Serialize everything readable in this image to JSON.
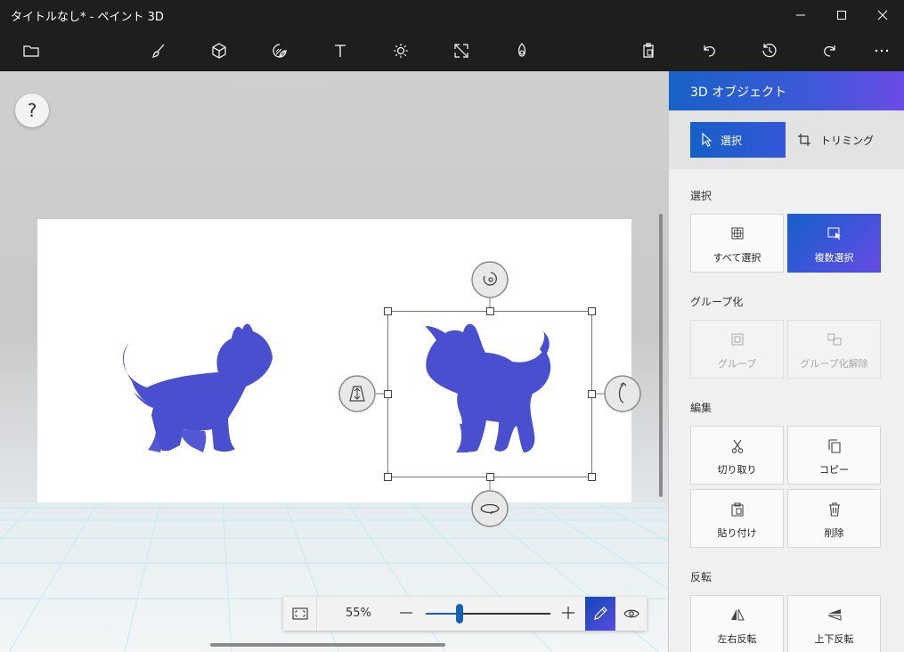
{
  "window": {
    "title": "タイトルなし* - ペイント 3D",
    "controls": [
      "minimize-icon",
      "maximize-icon",
      "close-icon"
    ]
  },
  "toolbar": {
    "left_items": [
      {
        "icon": "folder-icon"
      },
      {
        "icon": "brushes-icon"
      },
      {
        "icon": "3d-shapes-icon"
      },
      {
        "icon": "stickers-icon"
      },
      {
        "icon": "text-icon"
      },
      {
        "icon": "effects-icon"
      },
      {
        "icon": "canvas-icon"
      },
      {
        "icon": "3d-library-icon"
      }
    ],
    "right_items": [
      {
        "icon": "paste-icon"
      },
      {
        "icon": "undo-icon"
      },
      {
        "icon": "history-icon"
      },
      {
        "icon": "redo-icon"
      },
      {
        "icon": "more-icon"
      }
    ]
  },
  "canvas": {
    "help_label": "?",
    "object_color": "#4a4fd0"
  },
  "zoom": {
    "percent_label": "55%",
    "level": 0.27
  },
  "panel": {
    "title": "3D オブジェクト",
    "modes": {
      "select": "選択",
      "crop": "トリミング"
    },
    "sections": {
      "select": {
        "label": "選択",
        "items": [
          {
            "label": "すべて選択",
            "icon": "select-all-icon",
            "state": "normal"
          },
          {
            "label": "複数選択",
            "icon": "multi-select-icon",
            "state": "active"
          }
        ]
      },
      "group": {
        "label": "グループ化",
        "items": [
          {
            "label": "グループ",
            "icon": "group-icon",
            "state": "disabled"
          },
          {
            "label": "グループ化解除",
            "icon": "ungroup-icon",
            "state": "disabled"
          }
        ]
      },
      "edit": {
        "label": "編集",
        "items": [
          {
            "label": "切り取り",
            "icon": "scissors-icon",
            "state": "normal"
          },
          {
            "label": "コピー",
            "icon": "copy-icon",
            "state": "normal"
          },
          {
            "label": "貼り付け",
            "icon": "paste-icon",
            "state": "normal"
          },
          {
            "label": "削除",
            "icon": "trash-icon",
            "state": "normal"
          }
        ]
      },
      "flip": {
        "label": "反転",
        "items": [
          {
            "label": "左右反転",
            "icon": "flip-horizontal-icon",
            "state": "normal"
          },
          {
            "label": "上下反転",
            "icon": "flip-vertical-icon",
            "state": "normal"
          }
        ]
      }
    }
  },
  "colors": {
    "accent": "#1560c8",
    "accent_end": "#6a4ae4",
    "titlebar": "#1e1e1e"
  }
}
